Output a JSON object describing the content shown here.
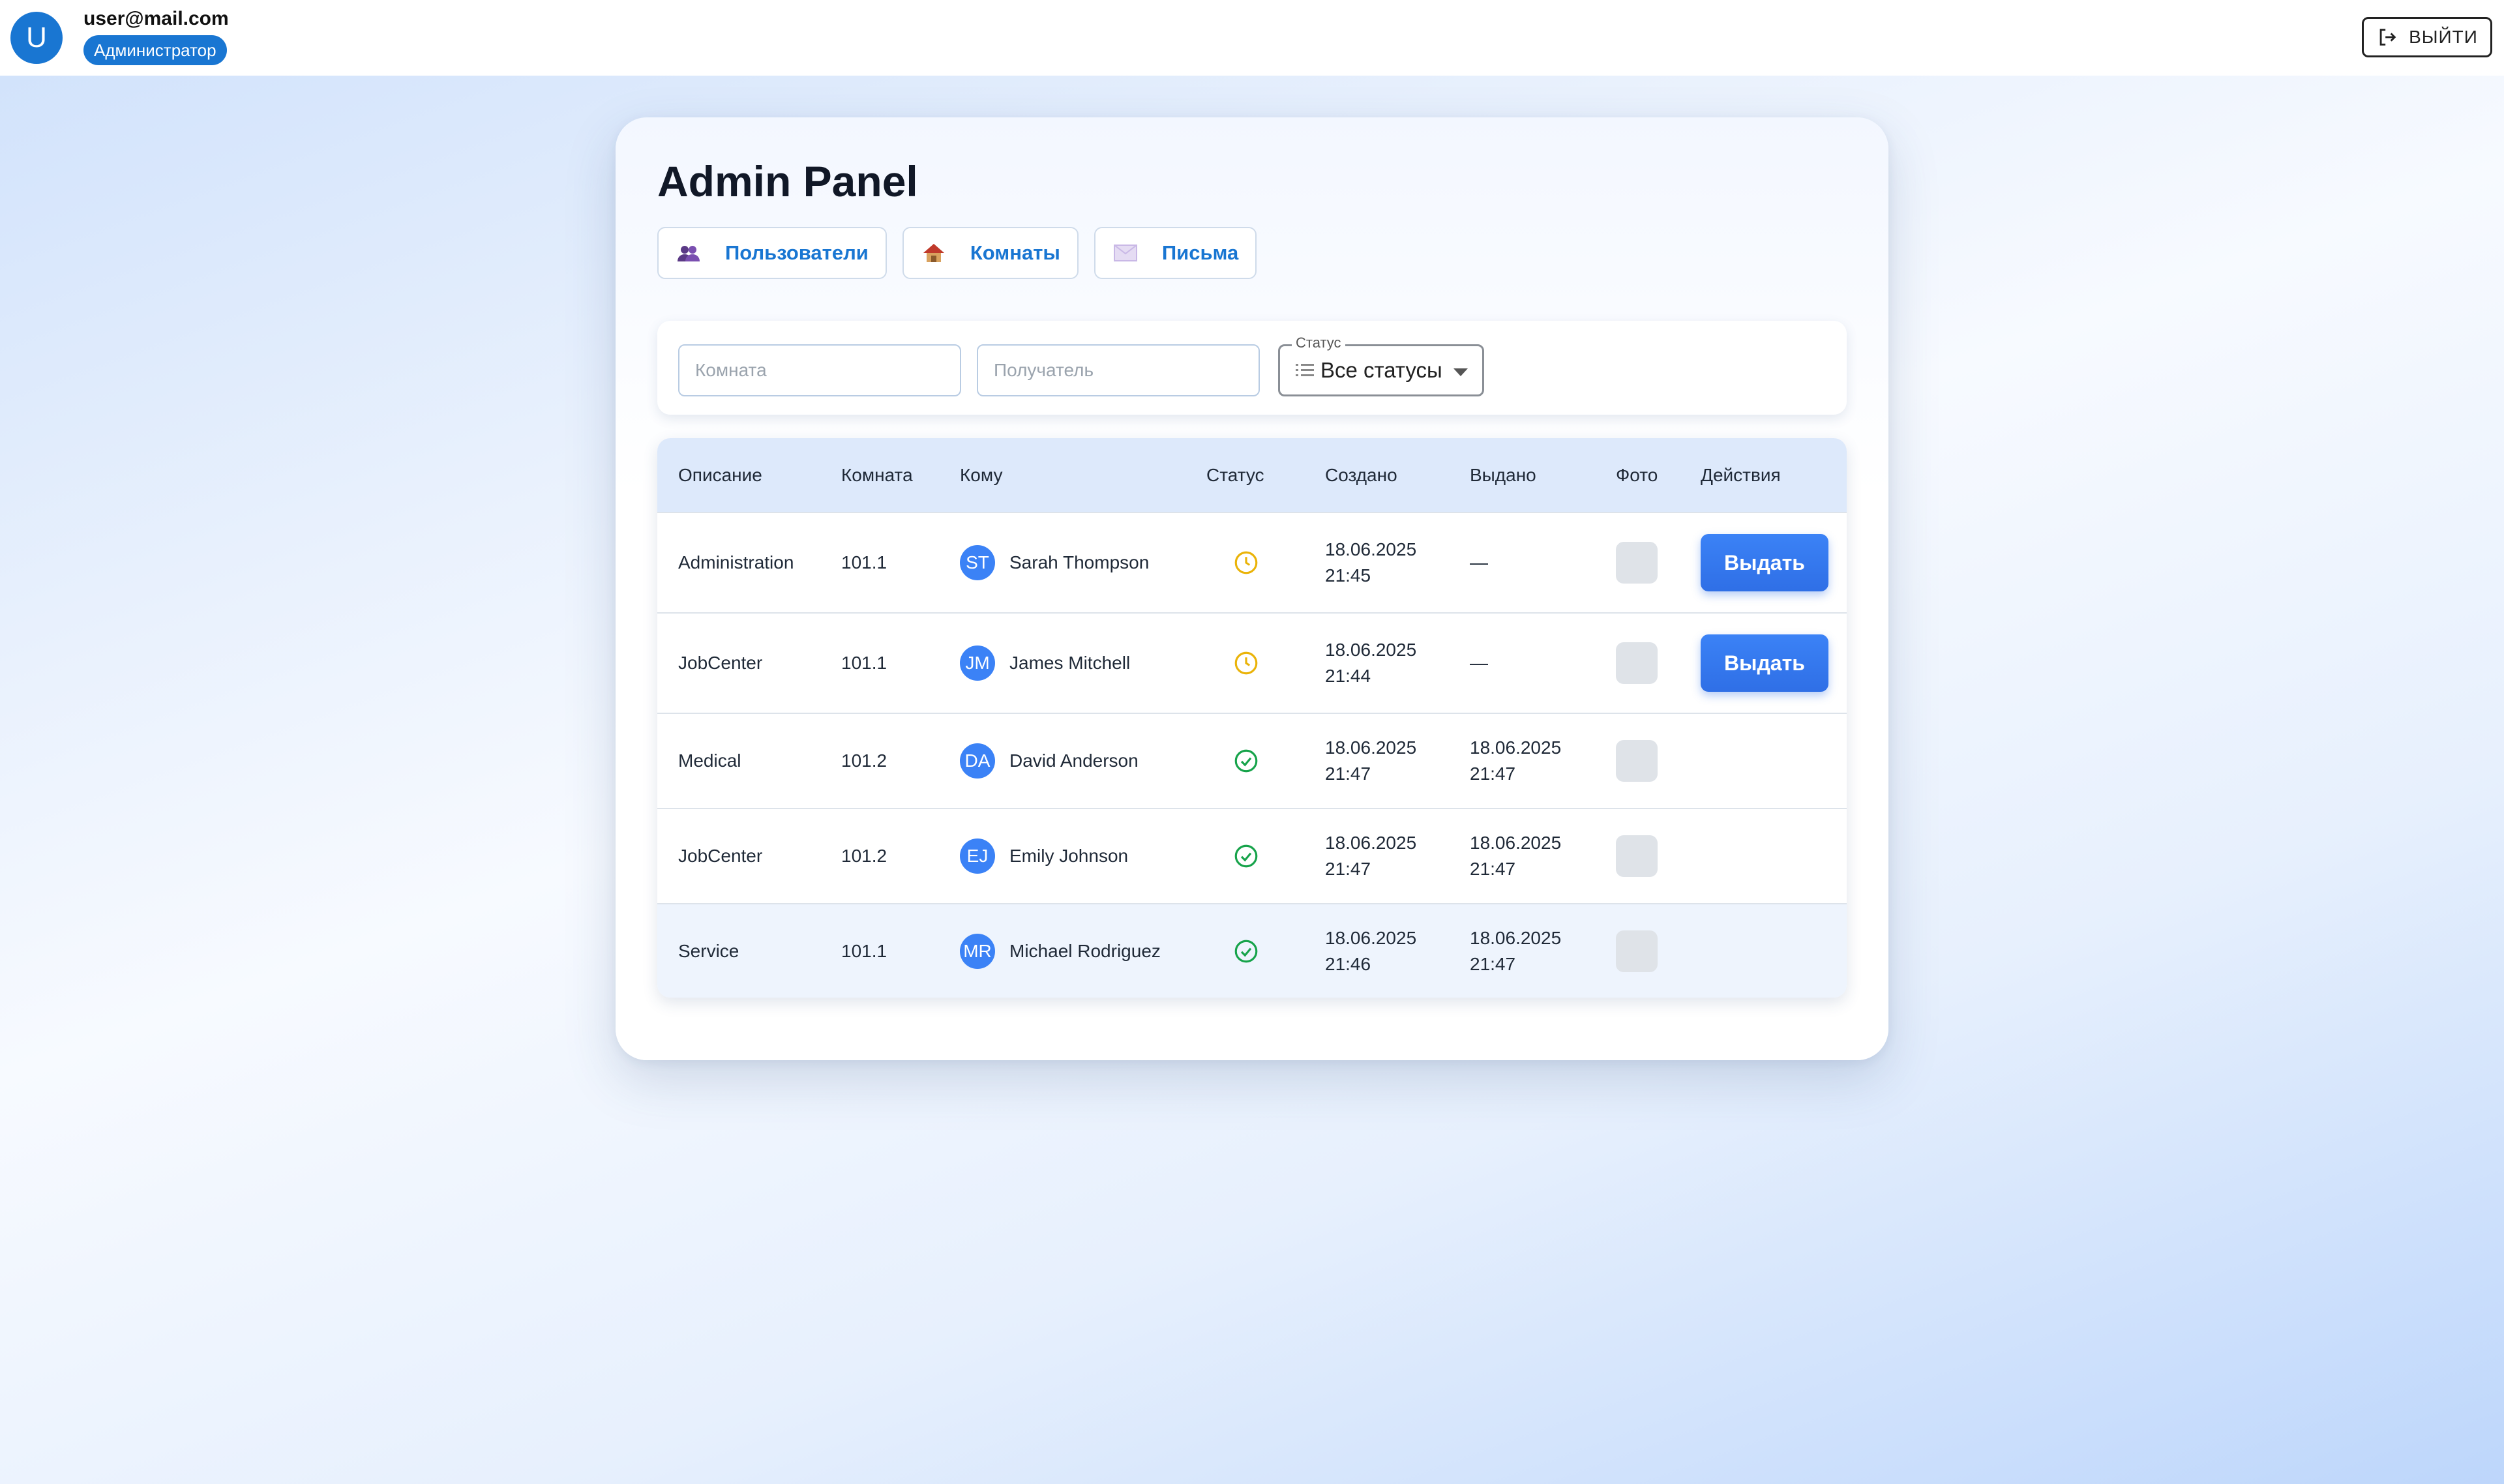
{
  "user": {
    "initial": "U",
    "email": "user@mail.com",
    "role": "Администратор"
  },
  "logout_label": "ВЫЙТИ",
  "page_title": "Admin Panel",
  "tabs": [
    {
      "icon": "users-icon",
      "label": "Пользователи"
    },
    {
      "icon": "house-icon",
      "label": "Комнаты"
    },
    {
      "icon": "envelope-icon",
      "label": "Письма"
    }
  ],
  "filters": {
    "room_placeholder": "Комната",
    "recipient_placeholder": "Получатель",
    "status_legend": "Статус",
    "status_value": "Все статусы"
  },
  "table": {
    "headers": [
      "Описание",
      "Комната",
      "Кому",
      "Статус",
      "Создано",
      "Выдано",
      "Фото",
      "Действия"
    ],
    "rows": [
      {
        "description": "Administration",
        "room": "101.1",
        "initials": "ST",
        "recipient": "Sarah Thompson",
        "status": "pending",
        "created_date": "18.06.2025",
        "created_time": "21:45",
        "issued": "—",
        "issued_time": "",
        "action": "Выдать"
      },
      {
        "description": "JobCenter",
        "room": "101.1",
        "initials": "JM",
        "recipient": "James Mitchell",
        "status": "pending",
        "created_date": "18.06.2025",
        "created_time": "21:44",
        "issued": "—",
        "issued_time": "",
        "action": "Выдать"
      },
      {
        "description": "Medical",
        "room": "101.2",
        "initials": "DA",
        "recipient": "David Anderson",
        "status": "issued",
        "created_date": "18.06.2025",
        "created_time": "21:47",
        "issued": "18.06.2025",
        "issued_time": "21:47",
        "action": ""
      },
      {
        "description": "JobCenter",
        "room": "101.2",
        "initials": "EJ",
        "recipient": "Emily Johnson",
        "status": "issued",
        "created_date": "18.06.2025",
        "created_time": "21:47",
        "issued": "18.06.2025",
        "issued_time": "21:47",
        "action": ""
      },
      {
        "description": "Service",
        "room": "101.1",
        "initials": "MR",
        "recipient": "Michael Rodriguez",
        "status": "issued",
        "created_date": "18.06.2025",
        "created_time": "21:46",
        "issued": "18.06.2025",
        "issued_time": "21:47",
        "action": ""
      }
    ]
  },
  "colors": {
    "primary": "#1976d2",
    "button": "#3b82f6",
    "pending": "#eab308",
    "issued": "#16a34a"
  }
}
